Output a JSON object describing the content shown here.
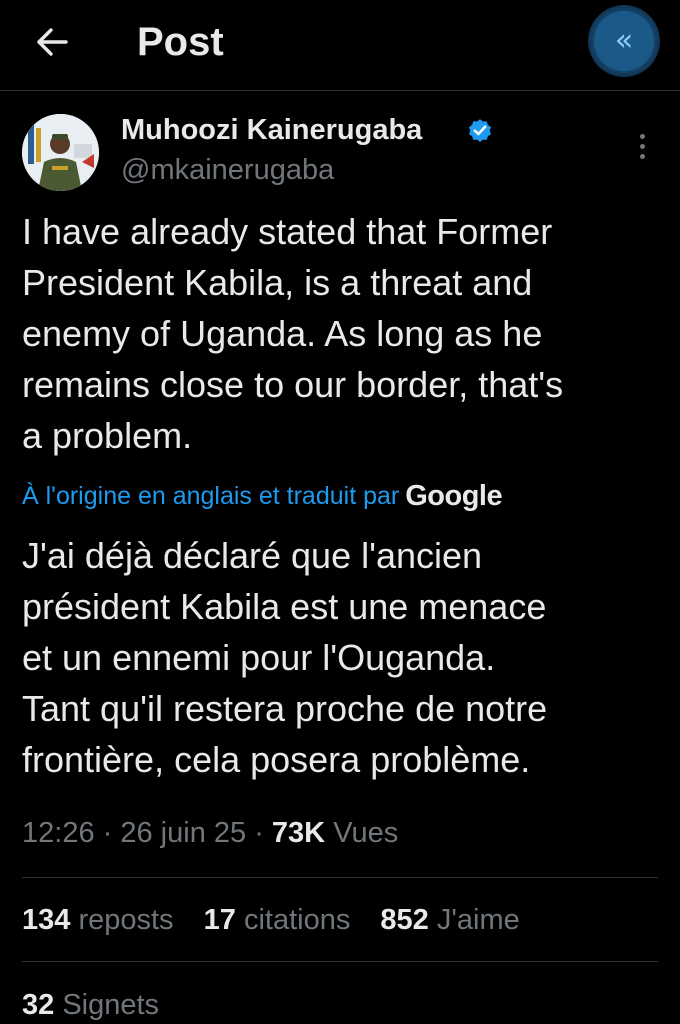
{
  "header": {
    "title": "Post",
    "back_icon": "arrow-left-icon",
    "collapse_icon": "chevrons-left-icon",
    "collapse_glyph": "«"
  },
  "author": {
    "name": "Muhoozi Kainerugaba",
    "handle": "@mkainerugaba",
    "verified": true,
    "verified_color": "#1d9bf0"
  },
  "post": {
    "lines": [
      "I have already stated that Former",
      "President Kabila, is a threat and",
      "enemy of Uganda. As long as he",
      "remains close to our border, that's",
      "a problem."
    ],
    "translation_notice": "À l'origine en anglais et traduit par",
    "translator_brand": "Google",
    "translated_lines": [
      "J'ai déjà déclaré que l'ancien",
      "président Kabila est une menace",
      "et un ennemi pour l'Ouganda.",
      "Tant qu'il restera proche de notre",
      "frontière, cela posera problème."
    ],
    "time": "12:26",
    "date": "26 juin 25",
    "views_count": "73K",
    "views_label": "Vues"
  },
  "stats": {
    "reposts_count": "134",
    "reposts_label": "reposts",
    "quotes_count": "17",
    "quotes_label": "citations",
    "likes_count": "852",
    "likes_label": "J'aime",
    "bookmarks_count": "32",
    "bookmarks_label": "Signets"
  },
  "colors": {
    "background": "#000000",
    "text": "#e7e9ea",
    "muted": "#71767b",
    "link": "#1d9bf0",
    "divider": "#2f3336"
  }
}
